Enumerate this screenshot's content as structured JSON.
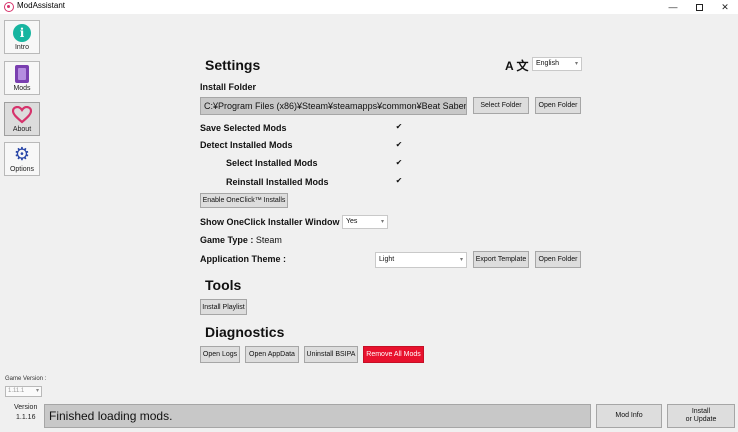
{
  "window": {
    "title": "ModAssistant"
  },
  "sidebar": {
    "items": [
      {
        "label": "Intro",
        "icon": "info-icon"
      },
      {
        "label": "Mods",
        "icon": "chip-icon"
      },
      {
        "label": "About",
        "icon": "heart-icon"
      },
      {
        "label": "Options",
        "icon": "gear-icon"
      }
    ],
    "game_version_label": "Game Version :",
    "game_version_value": "1.11.1",
    "version_label": "Version",
    "version_value": "1.1.16"
  },
  "settings": {
    "title": "Settings",
    "language": {
      "icon": "A 文",
      "value": "English"
    },
    "install_folder_label": "Install Folder",
    "install_path": "C:¥Program Files (x86)¥Steam¥steamapps¥common¥Beat Saber",
    "select_folder_button": "Select Folder",
    "open_folder_button": "Open Folder",
    "save_selected_mods": "Save Selected Mods",
    "detect_installed_mods": "Detect Installed Mods",
    "select_installed_mods": "Select Installed Mods",
    "reinstall_installed_mods": "Reinstall Installed Mods",
    "enable_oneclick_button": "Enable OneClick™ Installs",
    "show_oneclick_label": "Show OneClick Installer Window",
    "show_oneclick_value": "Yes",
    "game_type_label": "Game Type :",
    "game_type_value": "Steam",
    "theme_label": "Application Theme :",
    "theme_value": "Light",
    "export_template_button": "Export Template",
    "theme_open_folder_button": "Open Folder"
  },
  "tools": {
    "title": "Tools",
    "install_playlist_button": "Install Playlist"
  },
  "diagnostics": {
    "title": "Diagnostics",
    "open_logs_button": "Open Logs",
    "open_appdata_button": "Open AppData",
    "uninstall_bsipa_button": "Uninstall BSIPA",
    "remove_all_mods_button": "Remove All Mods"
  },
  "status_bar": {
    "message": "Finished loading mods.",
    "mod_info_button": "Mod Info",
    "install_line1": "Install",
    "install_line2": "or Update"
  },
  "colors": {
    "danger": "#e8112d",
    "info": "#17b5a0",
    "mods": "#7a3fb0",
    "about": "#d6336c",
    "options": "#2a47a8"
  }
}
